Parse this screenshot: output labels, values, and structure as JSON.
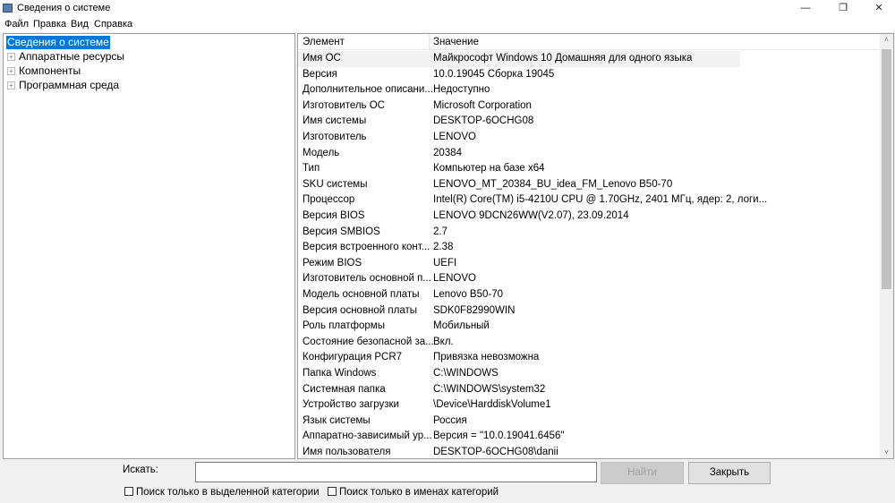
{
  "window": {
    "title": "Сведения о системе",
    "minimize": "—",
    "maximize": "❐",
    "close": "✕"
  },
  "menu": [
    "Файл",
    "Правка",
    "Вид",
    "Справка"
  ],
  "tree": {
    "root": "Сведения о системе",
    "items": [
      "Аппаратные ресурсы",
      "Компоненты",
      "Программная среда"
    ]
  },
  "table": {
    "headers": [
      "Элемент",
      "Значение"
    ],
    "rows": [
      [
        "Имя ОС",
        "Майкрософт Windows 10 Домашняя для одного языка"
      ],
      [
        "Версия",
        "10.0.19045 Сборка 19045"
      ],
      [
        "Дополнительное описани...",
        "Недоступно"
      ],
      [
        "Изготовитель ОС",
        "Microsoft Corporation"
      ],
      [
        "Имя системы",
        "DESKTOP-6OCHG08"
      ],
      [
        "Изготовитель",
        "LENOVO"
      ],
      [
        "Модель",
        "20384"
      ],
      [
        "Тип",
        "Компьютер на базе x64"
      ],
      [
        "SKU системы",
        "LENOVO_MT_20384_BU_idea_FM_Lenovo B50-70"
      ],
      [
        "Процессор",
        "Intel(R) Core(TM) i5-4210U CPU @ 1.70GHz, 2401 МГц, ядер: 2, логи..."
      ],
      [
        "Версия BIOS",
        "LENOVO 9DCN26WW(V2.07), 23.09.2014"
      ],
      [
        "Версия SMBIOS",
        "2.7"
      ],
      [
        "Версия встроенного конт...",
        "2.38"
      ],
      [
        "Режим BIOS",
        "UEFI"
      ],
      [
        "Изготовитель основной п...",
        "LENOVO"
      ],
      [
        "Модель основной платы",
        "Lenovo B50-70"
      ],
      [
        "Версия основной платы",
        "SDK0F82990WIN"
      ],
      [
        "Роль платформы",
        "Мобильный"
      ],
      [
        "Состояние безопасной за...",
        "Вкл."
      ],
      [
        "Конфигурация PCR7",
        "Привязка невозможна"
      ],
      [
        "Папка Windows",
        "C:\\WINDOWS"
      ],
      [
        "Системная папка",
        "C:\\WINDOWS\\system32"
      ],
      [
        "Устройство загрузки",
        "\\Device\\HarddiskVolume1"
      ],
      [
        "Язык системы",
        "Россия"
      ],
      [
        "Аппаратно-зависимый ур...",
        "Версия = \"10.0.19041.6456\""
      ],
      [
        "Имя пользователя",
        "DESKTOP-6OCHG08\\danii"
      ]
    ]
  },
  "search": {
    "label": "Искать:",
    "value": "",
    "find": "Найти",
    "close": "Закрыть",
    "opt1": "Поиск только в выделенной категории",
    "opt2": "Поиск только в именах категорий"
  }
}
